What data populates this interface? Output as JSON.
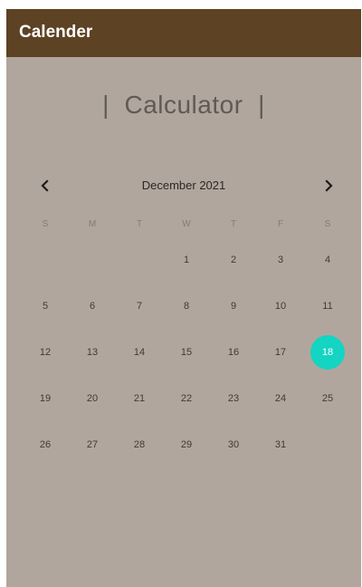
{
  "app_bar": {
    "title": "Calender"
  },
  "headline": "|  Calculator  |",
  "calendar": {
    "month_label": "December 2021",
    "selected_day": "18",
    "accent_color": "#14d4c2",
    "weekdays": [
      "S",
      "M",
      "T",
      "W",
      "T",
      "F",
      "S"
    ],
    "weeks": [
      [
        "",
        "",
        "",
        "1",
        "2",
        "3",
        "4"
      ],
      [
        "5",
        "6",
        "7",
        "8",
        "9",
        "10",
        "11"
      ],
      [
        "12",
        "13",
        "14",
        "15",
        "16",
        "17",
        "18"
      ],
      [
        "19",
        "20",
        "21",
        "22",
        "23",
        "24",
        "25"
      ],
      [
        "26",
        "27",
        "28",
        "29",
        "30",
        "31",
        ""
      ]
    ],
    "icons": {
      "prev": "chevron-left-icon",
      "next": "chevron-right-icon"
    }
  }
}
